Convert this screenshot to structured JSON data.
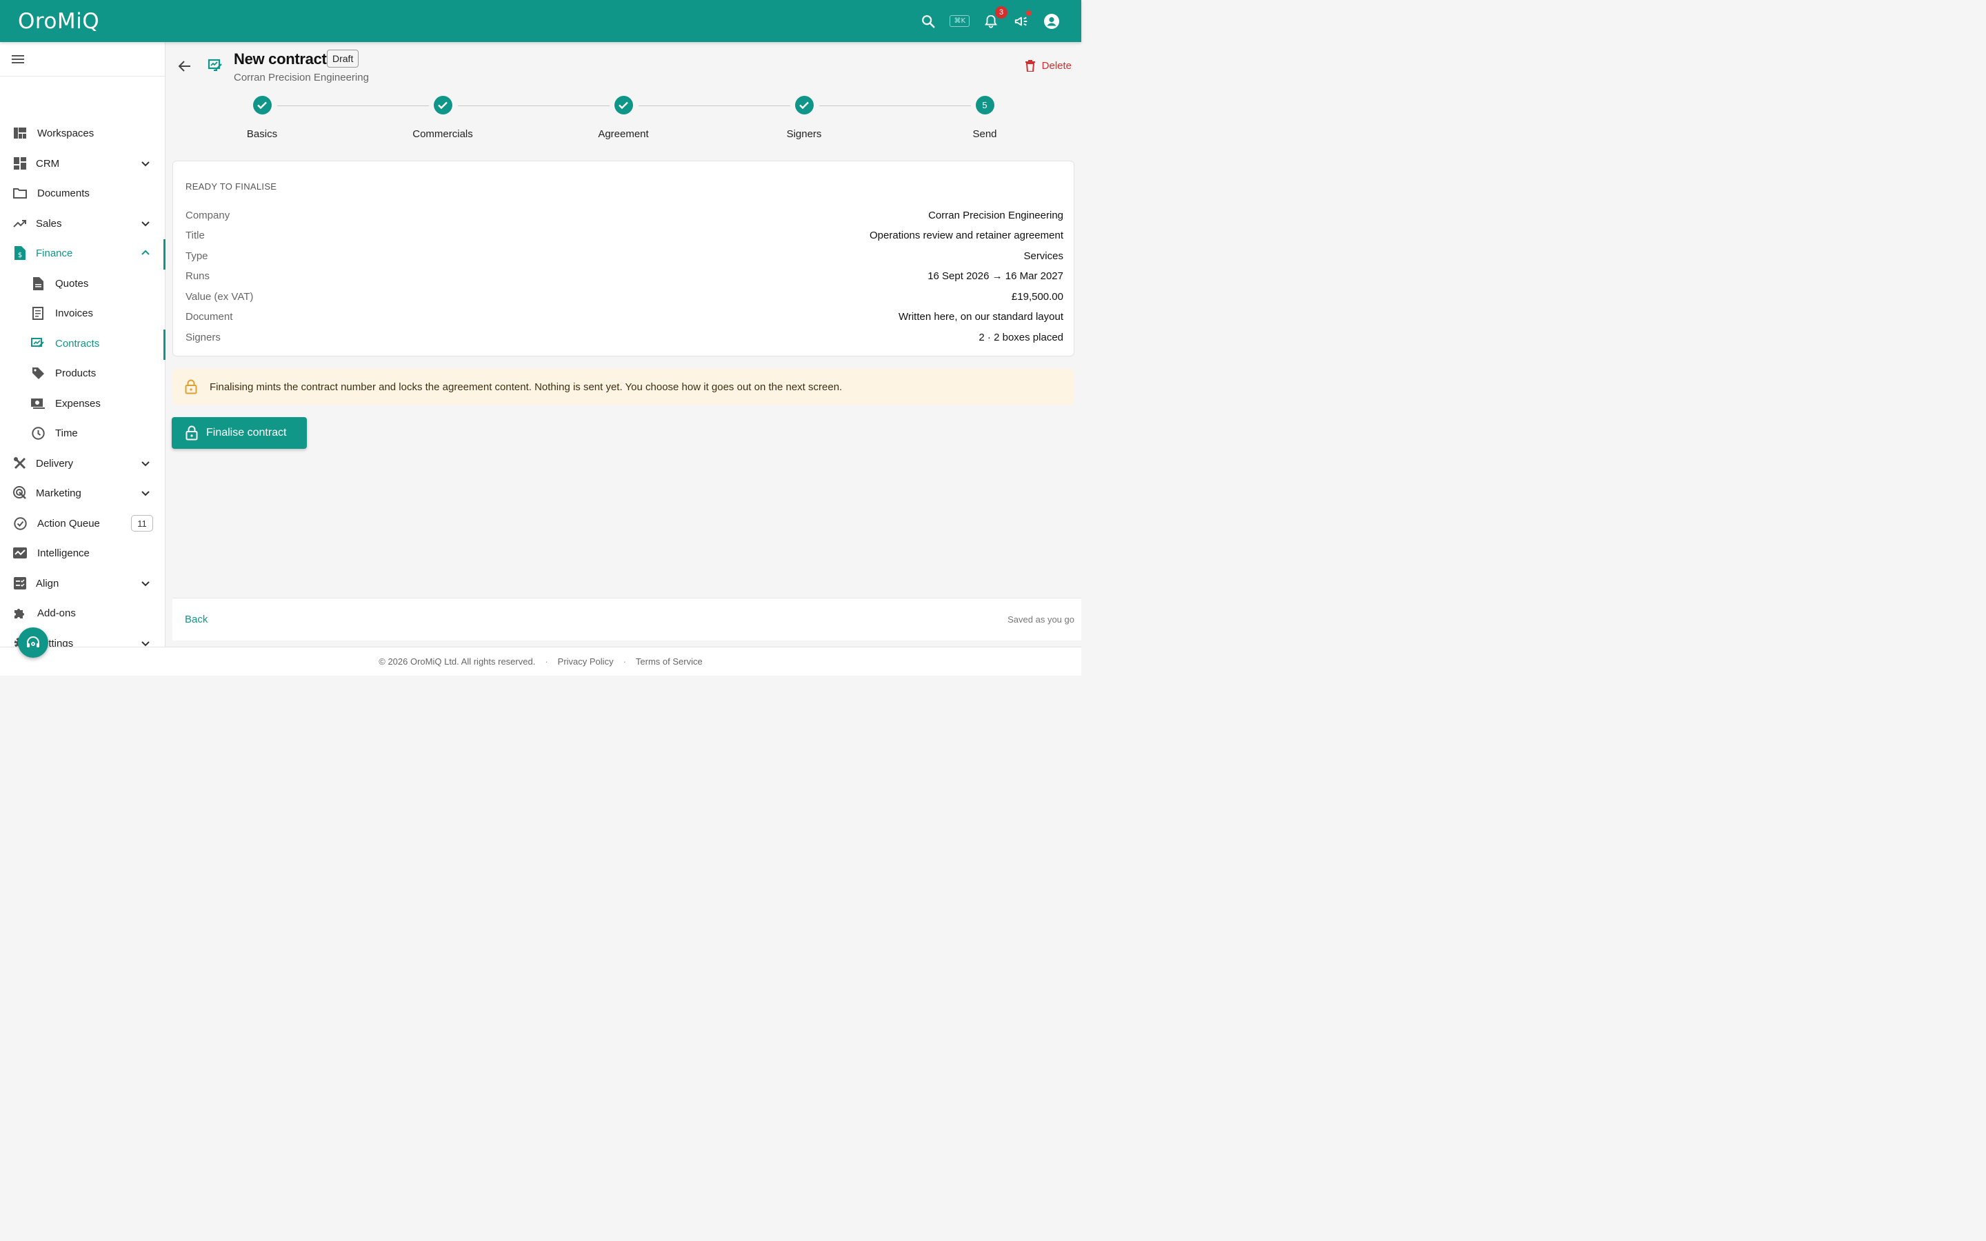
{
  "app": {
    "logo": "OroMiQ",
    "shortcut_hint": "⌘K",
    "notifications_count": "3",
    "colors": {
      "brand": "#0f9688",
      "danger": "#d32f2f",
      "notice_bg": "#fdf4e4",
      "notice_icon": "#e0a030"
    }
  },
  "topbar": {
    "icons": [
      "search-icon",
      "bell-icon",
      "megaphone-icon",
      "account-icon"
    ]
  },
  "sidebar": {
    "items": [
      {
        "label": "Workspaces",
        "icon": "workspaces-icon"
      },
      {
        "label": "CRM",
        "icon": "dashboard-icon",
        "expandable": true
      },
      {
        "label": "Documents",
        "icon": "folder-icon"
      },
      {
        "label": "Sales",
        "icon": "trending-up-icon",
        "expandable": true
      },
      {
        "label": "Finance",
        "icon": "finance-doc-icon",
        "expandable": true,
        "expanded": true,
        "active": true
      },
      {
        "label": "Quotes",
        "icon": "document-icon",
        "sub": true
      },
      {
        "label": "Invoices",
        "icon": "receipt-icon",
        "sub": true
      },
      {
        "label": "Contracts",
        "icon": "contract-icon",
        "sub": true,
        "active": true
      },
      {
        "label": "Products",
        "icon": "tag-icon",
        "sub": true
      },
      {
        "label": "Expenses",
        "icon": "wallet-icon",
        "sub": true
      },
      {
        "label": "Time",
        "icon": "clock-icon",
        "sub": true
      },
      {
        "label": "Delivery",
        "icon": "tools-icon",
        "expandable": true
      },
      {
        "label": "Marketing",
        "icon": "target-icon",
        "expandable": true
      },
      {
        "label": "Action Queue",
        "icon": "check-circle-icon",
        "badge": "11"
      },
      {
        "label": "Intelligence",
        "icon": "analytics-icon"
      },
      {
        "label": "Align",
        "icon": "checklist-icon",
        "expandable": true
      },
      {
        "label": "Add-ons",
        "icon": "puzzle-icon"
      },
      {
        "label": "Settings",
        "icon": "gear-icon",
        "expandable": true
      }
    ]
  },
  "header": {
    "title": "New contract",
    "status": "Draft",
    "subtitle": "Corran Precision Engineering",
    "delete_label": "Delete"
  },
  "stepper": {
    "steps": [
      {
        "label": "Basics",
        "done": true
      },
      {
        "label": "Commercials",
        "done": true
      },
      {
        "label": "Agreement",
        "done": true
      },
      {
        "label": "Signers",
        "done": true
      },
      {
        "label": "Send",
        "done": false,
        "number": "5"
      }
    ]
  },
  "summary": {
    "heading": "READY TO FINALISE",
    "rows": [
      {
        "key": "Company",
        "value": "Corran Precision Engineering"
      },
      {
        "key": "Title",
        "value": "Operations review and retainer agreement"
      },
      {
        "key": "Type",
        "value": "Services"
      },
      {
        "key": "Runs",
        "value": "16 Sept 2026 → 16 Mar 2027"
      },
      {
        "key": "Value (ex VAT)",
        "value": "£19,500.00"
      },
      {
        "key": "Document",
        "value": "Written here, on our standard layout"
      },
      {
        "key": "Signers",
        "value": "2 · 2 boxes placed"
      }
    ]
  },
  "notice": {
    "text": "Finalising mints the contract number and locks the agreement content. Nothing is sent yet. You choose how it goes out on the next screen."
  },
  "actions": {
    "finalise_label": "Finalise contract",
    "back_label": "Back",
    "saved_text": "Saved as you go"
  },
  "footer": {
    "copyright": "© 2026 OroMiQ Ltd. All rights reserved.",
    "sep1": "·",
    "privacy": "Privacy Policy",
    "sep2": "·",
    "terms": "Terms of Service"
  }
}
